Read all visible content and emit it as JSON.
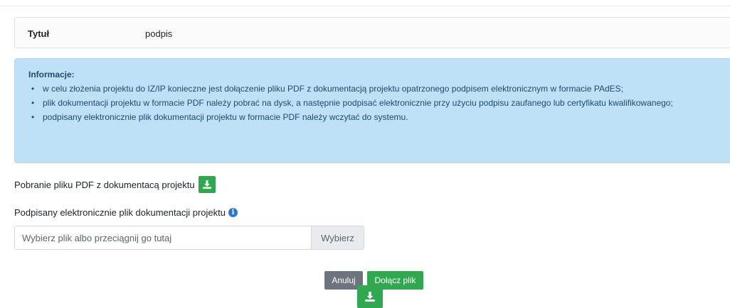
{
  "title_card": {
    "label": "Tytuł",
    "value": "podpis"
  },
  "info": {
    "heading": "Informacje:",
    "items": [
      "w celu złożenia projektu do IZ/IP konieczne jest dołączenie pliku PDF z dokumentacją projektu opatrzonego podpisem elektronicznym w formacie PAdES;",
      "plik dokumentacji projektu w formacie PDF należy pobrać na dysk, a następnie podpisać elektronicznie przy użyciu podpisu zaufanego lub certyfikatu kwalifikowanego;",
      "podpisany elektronicznie plik dokumentacji projektu w formacie PDF należy wczytać do systemu."
    ]
  },
  "download": {
    "label": "Pobranie pliku PDF z dokumentacą projektu",
    "icon": "download-icon"
  },
  "signed_file": {
    "label": "Podpisany elektronicznie plik dokumentacji projektu",
    "info_icon": "i",
    "placeholder": "Wybierz plik albo przeciągnij go tutaj",
    "browse_label": "Wybierz"
  },
  "actions": {
    "cancel_label": "Anuluj",
    "attach_label": "Dołącz plik"
  },
  "colors": {
    "success": "#2fa84f",
    "secondary": "#6c757d",
    "info_bg": "#bfe1f7",
    "info_text": "#1e4a6b",
    "info_icon": "#2d74d8"
  }
}
